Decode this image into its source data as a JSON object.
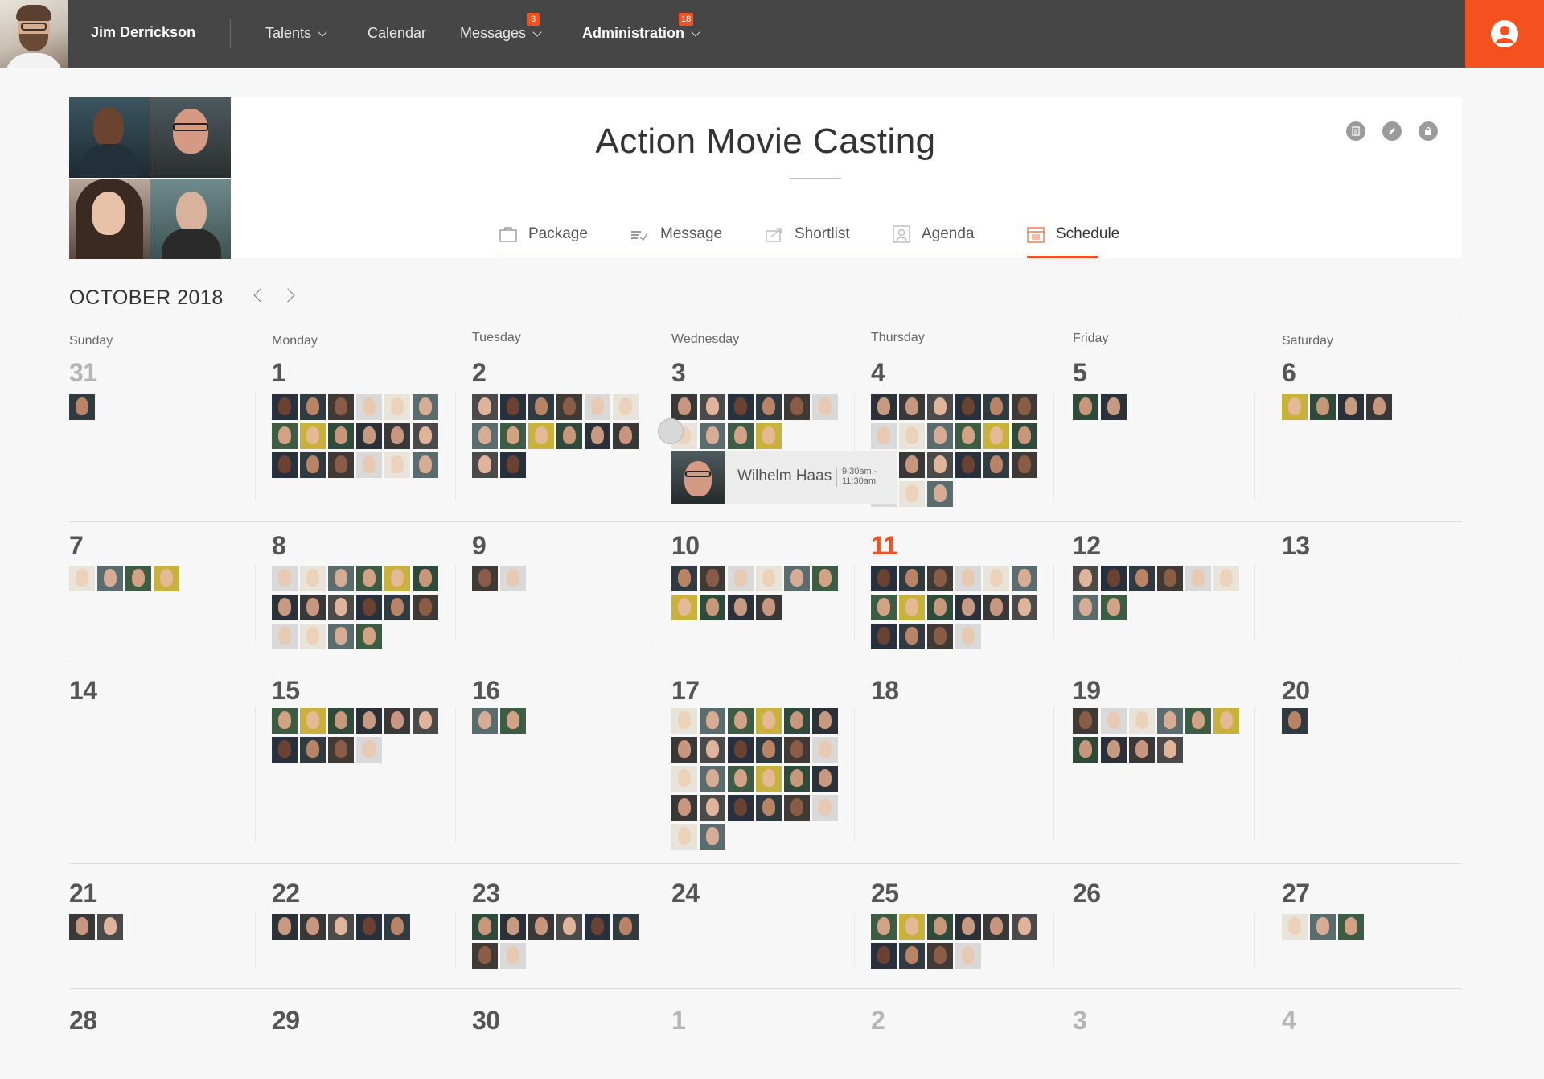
{
  "topbar": {
    "user_name": "Jim Derrickson",
    "nav": [
      {
        "label": "Talents",
        "dropdown": true,
        "badge": ""
      },
      {
        "label": "Calendar",
        "dropdown": false,
        "badge": ""
      },
      {
        "label": "Messages",
        "dropdown": true,
        "badge": "3"
      },
      {
        "label": "Administration",
        "dropdown": true,
        "badge": "18"
      }
    ],
    "account_icon": "user-circle-icon",
    "accent": "#f4511e"
  },
  "project": {
    "title": "Action Movie Casting",
    "actions": [
      "document-icon",
      "edit-icon",
      "lock-icon"
    ],
    "tabs": [
      {
        "label": "Package",
        "icon": "briefcase-icon",
        "active": false
      },
      {
        "label": "Message",
        "icon": "message-icon",
        "active": false
      },
      {
        "label": "Shortlist",
        "icon": "share-icon",
        "active": false
      },
      {
        "label": "Agenda",
        "icon": "agenda-icon",
        "active": false
      },
      {
        "label": "Schedule",
        "icon": "calendar-icon",
        "active": true
      }
    ]
  },
  "calendar": {
    "month_label": "OCTOBER 2018",
    "weekdays": [
      "Sunday",
      "Monday",
      "Tuesday",
      "Wednesday",
      "Thursday",
      "Friday",
      "Saturday"
    ],
    "weeks": [
      [
        {
          "day": "31",
          "state": "muted",
          "thumbs": 1
        },
        {
          "day": "1",
          "state": "normal",
          "thumbs": 18
        },
        {
          "day": "2",
          "state": "normal",
          "thumbs": 14
        },
        {
          "day": "3",
          "state": "normal",
          "thumbs": 10
        },
        {
          "day": "4",
          "state": "normal",
          "thumbs": 21
        },
        {
          "day": "5",
          "state": "normal",
          "thumbs": 2
        },
        {
          "day": "6",
          "state": "normal",
          "thumbs": 4
        }
      ],
      [
        {
          "day": "7",
          "state": "normal",
          "thumbs": 4
        },
        {
          "day": "8",
          "state": "normal",
          "thumbs": 16
        },
        {
          "day": "9",
          "state": "normal",
          "thumbs": 2
        },
        {
          "day": "10",
          "state": "normal",
          "thumbs": 10
        },
        {
          "day": "11",
          "state": "today",
          "thumbs": 16
        },
        {
          "day": "12",
          "state": "normal",
          "thumbs": 8
        },
        {
          "day": "13",
          "state": "normal",
          "thumbs": 0
        }
      ],
      [
        {
          "day": "14",
          "state": "normal",
          "thumbs": 0
        },
        {
          "day": "15",
          "state": "normal",
          "thumbs": 10
        },
        {
          "day": "16",
          "state": "normal",
          "thumbs": 2
        },
        {
          "day": "17",
          "state": "normal",
          "thumbs": 26
        },
        {
          "day": "18",
          "state": "normal",
          "thumbs": 0
        },
        {
          "day": "19",
          "state": "normal",
          "thumbs": 10
        },
        {
          "day": "20",
          "state": "normal",
          "thumbs": 1
        }
      ],
      [
        {
          "day": "21",
          "state": "normal",
          "thumbs": 2
        },
        {
          "day": "22",
          "state": "normal",
          "thumbs": 5
        },
        {
          "day": "23",
          "state": "normal",
          "thumbs": 8
        },
        {
          "day": "24",
          "state": "normal",
          "thumbs": 0
        },
        {
          "day": "25",
          "state": "normal",
          "thumbs": 10
        },
        {
          "day": "26",
          "state": "normal",
          "thumbs": 0
        },
        {
          "day": "27",
          "state": "normal",
          "thumbs": 3
        }
      ],
      [
        {
          "day": "28",
          "state": "normal",
          "thumbs": 0
        },
        {
          "day": "29",
          "state": "normal",
          "thumbs": 0
        },
        {
          "day": "30",
          "state": "normal",
          "thumbs": 0
        },
        {
          "day": "1",
          "state": "muted",
          "thumbs": 0
        },
        {
          "day": "2",
          "state": "muted",
          "thumbs": 0
        },
        {
          "day": "3",
          "state": "muted",
          "thumbs": 0
        },
        {
          "day": "4",
          "state": "muted",
          "thumbs": 0
        }
      ]
    ]
  },
  "popover": {
    "name": "Wilhelm Haas",
    "time_start": "9:30am -",
    "time_end": "11:30am"
  }
}
